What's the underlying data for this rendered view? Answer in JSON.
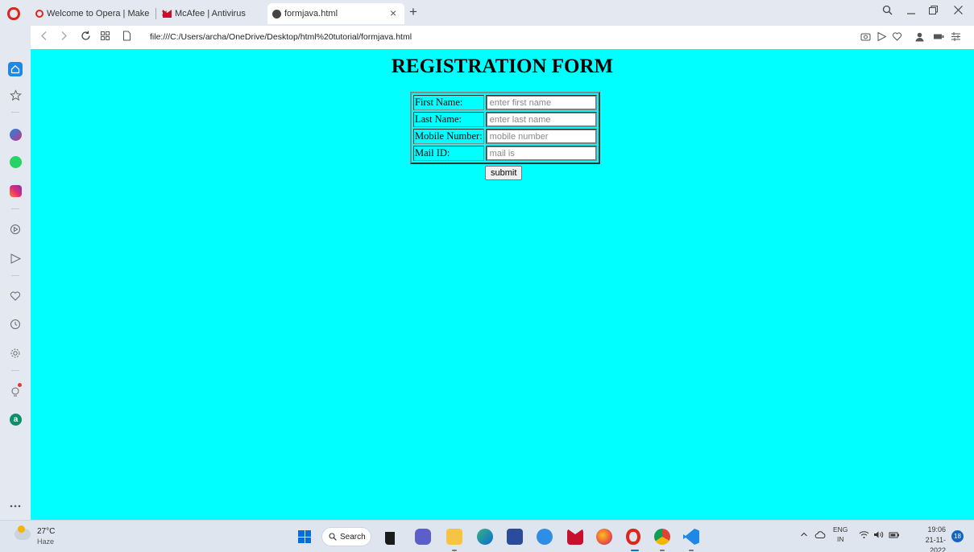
{
  "browser": {
    "tabs": [
      {
        "title": "Welcome to Opera | Make",
        "favicon": "opera-icon"
      },
      {
        "title": "McAfee | Antivirus",
        "favicon": "mcafee-icon"
      },
      {
        "title": "formjava.html",
        "favicon": "globe-icon",
        "active": true
      }
    ],
    "close_glyph": "×",
    "new_tab_glyph": "+",
    "url": "file:///C:/Users/archa/OneDrive/Desktop/html%20tutorial/formjava.html"
  },
  "page": {
    "title": "REGISTRATION FORM",
    "background_color": "#00ffff",
    "fields": [
      {
        "label": "First Name:",
        "placeholder": "enter first name"
      },
      {
        "label": "Last Name:",
        "placeholder": "enter last name"
      },
      {
        "label": "Mobile Number:",
        "placeholder": "mobile number"
      },
      {
        "label": "Mail ID:",
        "placeholder": "mail is"
      }
    ],
    "submit_label": "submit"
  },
  "taskbar": {
    "weather_temp": "27°C",
    "weather_desc": "Haze",
    "search_label": "Search",
    "lang_top": "ENG",
    "lang_bottom": "IN",
    "time": "19:06",
    "date": "21-11-2022",
    "notification_count": "18"
  },
  "colors": {
    "accent": "#1e88e5",
    "opera_red": "#e2231a"
  }
}
